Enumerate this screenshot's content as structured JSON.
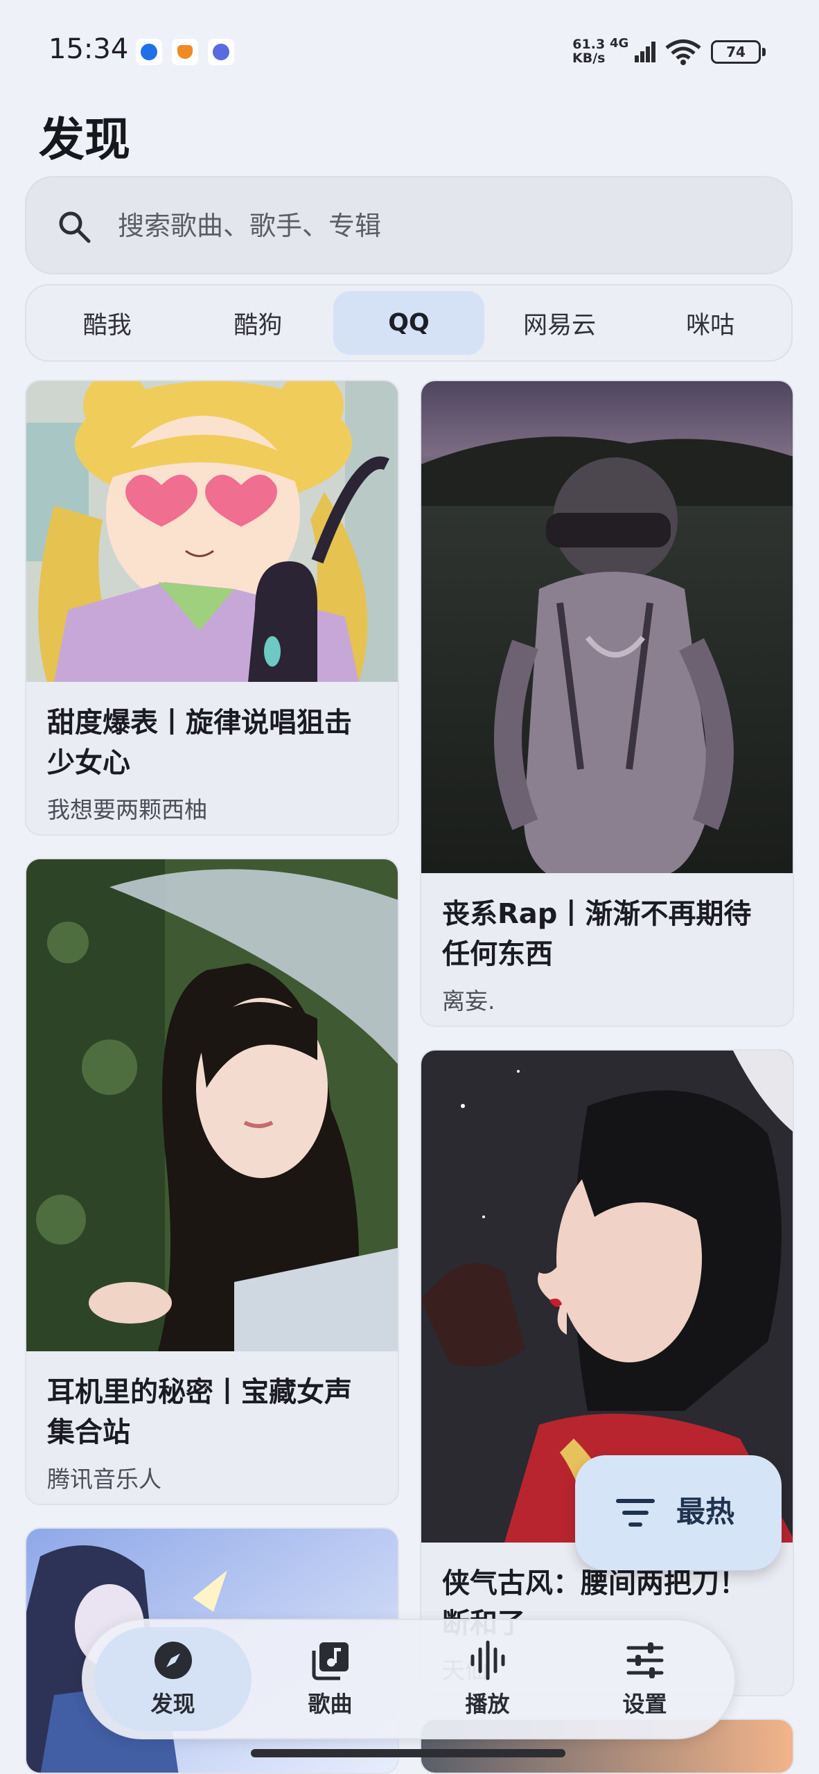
{
  "status_bar": {
    "time": "15:34",
    "net_speed_value": "61.3",
    "net_speed_unit": "KB/s",
    "net_type": "4G",
    "battery": "74"
  },
  "page": {
    "title": "发现"
  },
  "search": {
    "placeholder": "搜索歌曲、歌手、专辑"
  },
  "tabs": [
    {
      "label": "酷我",
      "active": false
    },
    {
      "label": "酷狗",
      "active": false
    },
    {
      "label": "QQ",
      "active": true
    },
    {
      "label": "网易云",
      "active": false
    },
    {
      "label": "咪咕",
      "active": false
    }
  ],
  "playlists": [
    {
      "title": "甜度爆表丨旋律说唱狙击少女心",
      "author": "我想要两颗西柚"
    },
    {
      "title": "丧系Rap丨渐渐不再期待任何东西",
      "author": "离妄."
    },
    {
      "title": "耳机里的秘密丨宝藏女声集合站",
      "author": "腾讯音乐人"
    },
    {
      "title": "侠气古风：腰间两把刀！断和了",
      "author": "天仙"
    }
  ],
  "sort_button": {
    "label": "最热",
    "icon": "filter-icon"
  },
  "bottom_nav": [
    {
      "label": "发现",
      "icon": "compass-icon",
      "active": true
    },
    {
      "label": "歌曲",
      "icon": "music-library-icon",
      "active": false
    },
    {
      "label": "播放",
      "icon": "waveform-icon",
      "active": false
    },
    {
      "label": "设置",
      "icon": "sliders-icon",
      "active": false
    }
  ],
  "colors": {
    "background": "#eff1f9",
    "accent_soft": "#d5e2f6",
    "surface": "#eaecf3",
    "text_primary": "#1b1c22"
  }
}
